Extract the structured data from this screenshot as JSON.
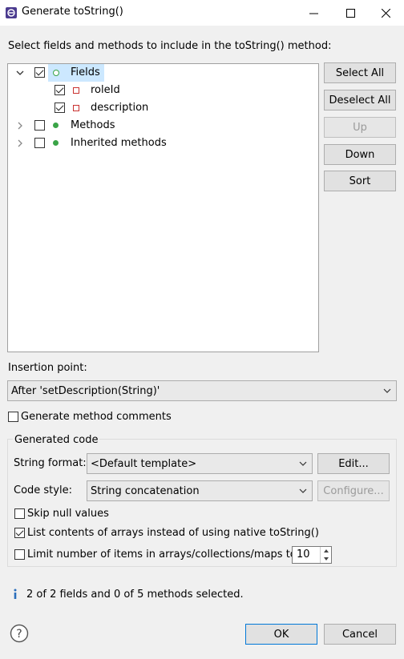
{
  "window": {
    "title": "Generate toString()",
    "minimize_glyph": "—",
    "maximize_glyph": "☐",
    "close_glyph": "✕"
  },
  "instruction": "Select fields and methods to include in the toString() method:",
  "tree": {
    "nodes": [
      {
        "label": "Fields",
        "expanded": true,
        "checked": true,
        "icon": "field-group-icon"
      },
      {
        "label": "roleId",
        "checked": true,
        "icon": "private-field-icon"
      },
      {
        "label": "description",
        "checked": true,
        "icon": "private-field-icon"
      },
      {
        "label": "Methods",
        "expanded": false,
        "checked": false,
        "icon": "method-group-icon"
      },
      {
        "label": "Inherited methods",
        "expanded": false,
        "checked": false,
        "icon": "method-group-icon"
      }
    ]
  },
  "side_buttons": {
    "select_all": "Select All",
    "deselect_all": "Deselect All",
    "up": "Up",
    "down": "Down",
    "sort": "Sort"
  },
  "insertion": {
    "label": "Insertion point:",
    "value": "After 'setDescription(String)'"
  },
  "generate_comments": {
    "label": "Generate method comments",
    "checked": false
  },
  "generated_code": {
    "legend": "Generated code",
    "string_format_label": "String format:",
    "string_format_value": "<Default template>",
    "edit_button": "Edit...",
    "code_style_label": "Code style:",
    "code_style_value": "String concatenation",
    "configure_button": "Configure...",
    "skip_null": {
      "label": "Skip null values",
      "checked": false
    },
    "list_arrays": {
      "label": "List contents of arrays instead of using native toString()",
      "checked": true
    },
    "limit_items": {
      "label": "Limit number of items in arrays/collections/maps to",
      "checked": false,
      "value": "10"
    }
  },
  "status": {
    "icon": "info-icon",
    "text": "2 of 2 fields and 0 of 5 methods selected."
  },
  "footer": {
    "help_icon": "help-icon",
    "ok": "OK",
    "cancel": "Cancel"
  },
  "colors": {
    "selection": "#cce8ff",
    "default_button_border": "#0078d7",
    "field_icon": "#c9312f",
    "method_icon": "#3aa447"
  }
}
